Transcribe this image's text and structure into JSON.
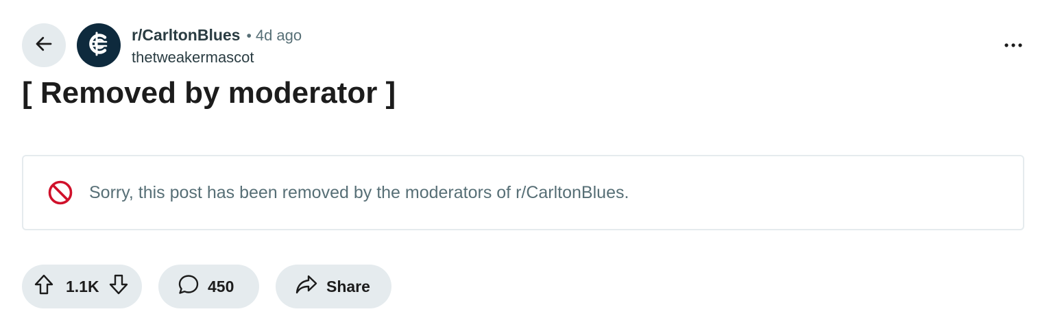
{
  "header": {
    "subreddit": "r/CarltonBlues",
    "separator": "•",
    "timestamp": "4d ago",
    "author": "thetweakermascot",
    "avatar_icon": "carlton-monogram-icon",
    "avatar_bg": "#0e2a3d"
  },
  "post": {
    "title": "[ Removed by moderator ]"
  },
  "removal_notice": {
    "text": "Sorry, this post has been removed by the moderators of r/CarltonBlues.",
    "icon": "prohibited-icon",
    "icon_color": "#d0112b"
  },
  "actions": {
    "vote_score": "1.1K",
    "comment_count": "450",
    "share_label": "Share"
  },
  "colors": {
    "pill_bg": "#e5ebee",
    "muted_text": "#576f76"
  }
}
